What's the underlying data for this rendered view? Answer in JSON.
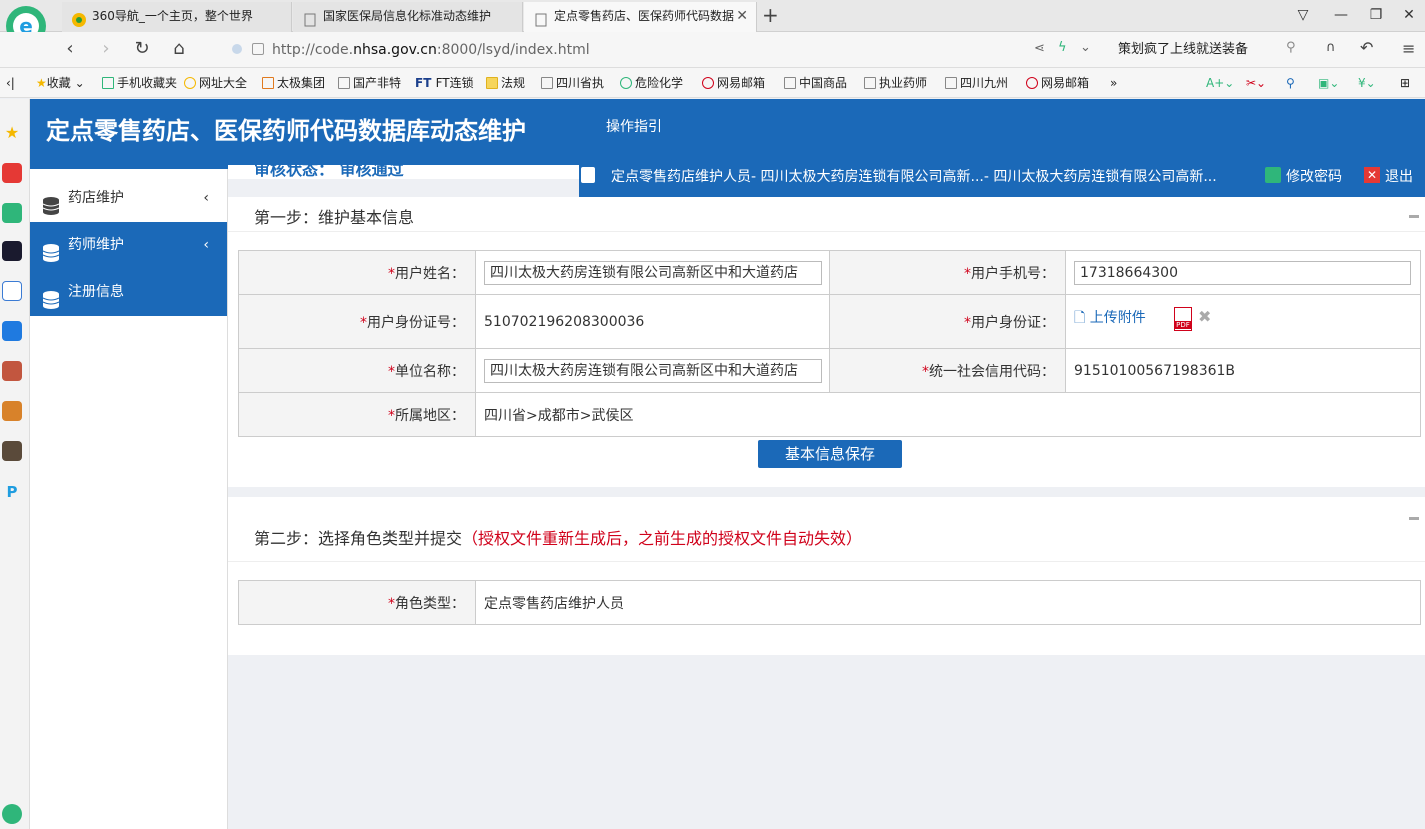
{
  "browser": {
    "tabs": [
      {
        "label": "360导航_一个主页，整个世界"
      },
      {
        "label": "国家医保局信息化标准动态维护"
      },
      {
        "label": "定点零售药店、医保药师代码数据"
      }
    ],
    "url_prefix": "http://code.",
    "url_host": "nhsa.gov.cn",
    "url_suffix": ":8000/lsyd/index.html",
    "search_text": "策划疯了上线就送装备",
    "bookmarks": [
      "收藏",
      "手机收藏夹",
      "网址大全",
      "太极集团",
      "国产非特",
      "FT连锁",
      "法规",
      "四川省执",
      "危险化学",
      "网易邮箱",
      "中国商品",
      "执业药师",
      "四川九州",
      "网易邮箱",
      "»"
    ]
  },
  "header": {
    "title": "定点零售药店、医保药师代码数据库动态维护",
    "guide": "操作指引",
    "user": "定点零售药店维护人员- 四川太极大药房连锁有限公司高新...- 四川太极大药房连锁有限公司高新...",
    "change_password": "修改密码",
    "logout": "退出"
  },
  "nav": {
    "items": [
      {
        "label": "药店维护"
      },
      {
        "label": "药师维护"
      },
      {
        "label": "注册信息"
      }
    ]
  },
  "status_partial": "审核状态：  审核通过",
  "step1": {
    "title": "第一步：维护基本信息",
    "user_name_label": "用户姓名：",
    "user_name_value": "四川太极大药房连锁有限公司高新区中和大道药店",
    "phone_label": "用户手机号：",
    "phone_value": "17318664300",
    "id_label": "用户身份证号：",
    "id_value": "510702196208300036",
    "id_card_label": "用户身份证：",
    "upload_label": "上传附件",
    "pdf_label": "PDF",
    "org_label": "单位名称：",
    "org_value": "四川太极大药房连锁有限公司高新区中和大道药店",
    "credit_label": "统一社会信用代码：",
    "credit_value": "91510100567198361B",
    "region_label": "所属地区：",
    "region_value": "四川省>成都市>武侯区",
    "save_button": "基本信息保存"
  },
  "step2": {
    "title": "第二步：选择角色类型并提交",
    "warning": "（授权文件重新生成后，之前生成的授权文件自动失效）",
    "role_label": "角色类型：",
    "role_value": "定点零售药店维护人员"
  },
  "required_mark": "*",
  "colors": {
    "primary": "#1b69b8",
    "required": "#d0021b"
  }
}
